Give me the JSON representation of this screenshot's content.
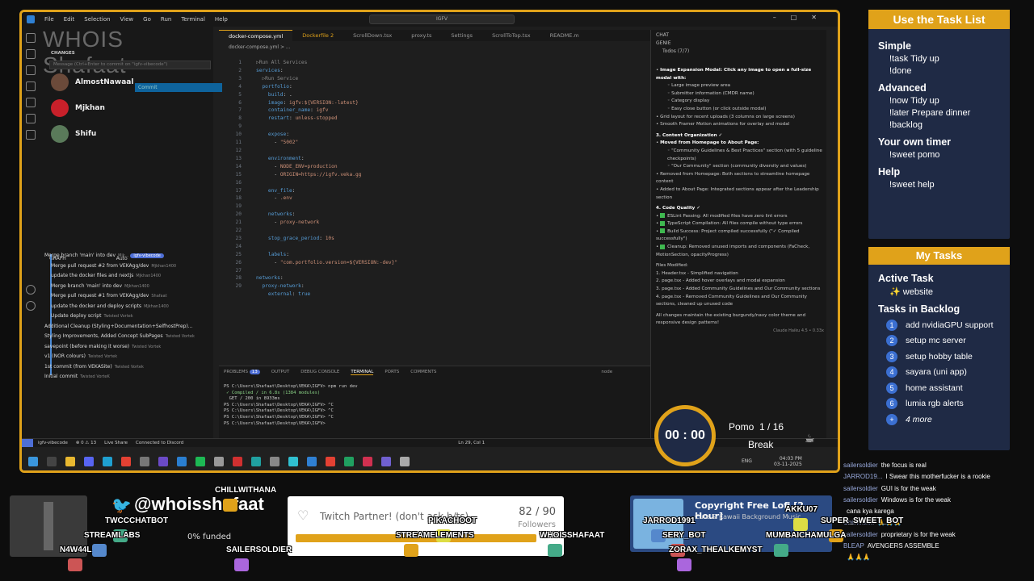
{
  "titlebar": {
    "menu": [
      "File",
      "Edit",
      "Selection",
      "View",
      "Go",
      "Run",
      "Terminal",
      "Help"
    ],
    "search": "IGFV"
  },
  "sidebar": {
    "section": "CHANGES",
    "message_placeholder": "Message (Ctrl+Enter to commit on \"igfv-vibecode\")",
    "commit_label": "Commit",
    "users": [
      "AlmostNawaal",
      "Mjkhan",
      "Shifu"
    ],
    "graph_label": "GRAPH",
    "graph_auto": "Auto"
  },
  "watermark": "WHOIS Shafaat",
  "commits": [
    {
      "msg": "Merge branch 'main' into dev",
      "author": "Mjk...",
      "badge": "igfv-vibecode"
    },
    {
      "msg": "Merge pull request #2 from VEKAgg/dev",
      "author": "Mjkhan1400"
    },
    {
      "msg": "update the docker files and nextjs",
      "author": "Mjkhan1400"
    },
    {
      "msg": "Merge branch 'main' into dev",
      "author": "Mjkhan1400"
    },
    {
      "msg": "Merge pull request #1 from VEKAgg/dev",
      "author": "Shafaat"
    },
    {
      "msg": "update the docker and deploy scripts",
      "author": "Mjkhan1400"
    },
    {
      "msg": "Update deploy script",
      "author": "Twisted Vortek"
    },
    {
      "msg": "Additional Cleanup (Styling+Documentation+SelfhostPrep)...",
      "author": ""
    },
    {
      "msg": "Styling Improvements, Added Concept SubPages",
      "author": "Twisted Vortek"
    },
    {
      "msg": "savepoint (before making it worse)",
      "author": "Twisted Vortek"
    },
    {
      "msg": "v1 (NOR colours)",
      "author": "Twisted Vortek"
    },
    {
      "msg": "1st commit (from VEKASite)",
      "author": "Twisted Vortek"
    },
    {
      "msg": "Initial commit",
      "author": "Twisted VorteK"
    }
  ],
  "tabs": [
    "docker-compose.yml",
    "Dockerfile 2",
    "ScrollDown.tsx",
    "proxy.ts",
    "Settings",
    "ScrollToTop.tsx",
    "README.m"
  ],
  "breadcrumb": "docker-compose.yml > ...",
  "editor": {
    "lines": [
      "1",
      "2",
      "3",
      "4",
      "5",
      "6",
      "7",
      "8",
      "9",
      "10",
      "11",
      "12",
      "13",
      "14",
      "15",
      "16",
      "17",
      "18",
      "19",
      "20",
      "21",
      "22",
      "23",
      "24",
      "25",
      "26",
      "27",
      "28",
      "29"
    ]
  },
  "panel": {
    "tabs": [
      "PROBLEMS",
      "OUTPUT",
      "DEBUG CONSOLE",
      "TERMINAL",
      "PORTS",
      "COMMENTS"
    ],
    "problems_count": "13",
    "shell": "node"
  },
  "terminal": [
    "PS C:\\Users\\Shafaat\\Desktop\\VEKA\\IGFV> npm run dev",
    " ✓ Compiled / in 6.8s (1384 modules)",
    "  GET / 200 in 8933ms",
    "PS C:\\Users\\Shafaat\\Desktop\\VEKA\\IGFV> ^C",
    "PS C:\\Users\\Shafaat\\Desktop\\VEKA\\IGFV> ^C",
    "PS C:\\Users\\Shafaat\\Desktop\\VEKA\\IGFV> ^C",
    "PS C:\\Users\\Shafaat\\Desktop\\VEKA\\IGFV> "
  ],
  "chat": {
    "title": "CHAT",
    "sub": "GENIE",
    "todos": "Todos (7/7)",
    "items": [
      "Image Expansion Modal: Click any image to open a full-size modal with:",
      "Large image preview area",
      "Submitter information (CMDR name)",
      "Category display",
      "Easy close button (or click outside modal)",
      "Grid layout for recent uploads (3 columns on large screens)",
      "Smooth Framer Motion animations for overlay and modal",
      "3. Content Organization ✓",
      "Moved from Homepage to About Page:",
      "\"Community Guidelines & Best Practices\" section (with 5 guideline checkpoints)",
      "\"Our Community\" section (community diversity and values)",
      "Removed from Homepage: Both sections to streamline homepage content",
      "Added to About Page: Integrated sections appear after the Leadership section",
      "4. Code Quality ✓",
      "ESLint Passing: All modified files have zero lint errors",
      "TypeScript Compilation: All files compile without type errors",
      "Build Success: Project compiled successfully (\"✓ Compiled successfully\")",
      "Cleanup: Removed unused imports and components (FaCheck, MotionSection, opacityProgress)",
      "Files Modified:",
      "Header.tsx - Simplified navigation",
      "page.tsx - Added hover overlays and modal expansion",
      "page.tsx - Added Community Guidelines and Our Community sections",
      "page.tsx - Removed Community Guidelines and Our Community sections, cleaned up unused code",
      "All changes maintain the existing burgundy/navy color theme and responsive design patterns!"
    ],
    "model": "Claude Haiku 4.5 • 0.33x"
  },
  "status": {
    "branch": "igfv-vibecode",
    "problems": "⊗ 0 ⚠ 13",
    "live": "Live Share",
    "discord": "Connected to Discord",
    "pos": "Ln 29, Col 1",
    "time": "04:03 PM",
    "date": "03-11-2025",
    "lang": "ENG"
  },
  "tasklist": {
    "title": "Use the Task List",
    "sections": [
      {
        "h": "Simple",
        "items": [
          "!task Tidy up",
          "!done"
        ]
      },
      {
        "h": "Advanced",
        "items": [
          "!now Tidy up",
          "!later Prepare dinner",
          "!backlog"
        ]
      },
      {
        "h": "Your own timer",
        "items": [
          "!sweet pomo"
        ]
      },
      {
        "h": "Help",
        "items": [
          "!sweet help"
        ]
      }
    ]
  },
  "mytasks": {
    "title": "My Tasks",
    "active_label": "Active Task",
    "active": "✨ website",
    "backlog_label": "Tasks in Backlog",
    "backlog": [
      "add nvidiaGPU support",
      "setup mc server",
      "setup hobby table",
      "sayara (uni app)",
      "home assistant",
      "lumia rgb alerts"
    ],
    "more": "4 more"
  },
  "pomo": {
    "time": "00 : 00",
    "label": "Pomo",
    "count": "1 / 16",
    "state": "Break"
  },
  "chatlog": [
    {
      "u": "sailersoldier",
      "m": "the focus is real"
    },
    {
      "u": "JARROD19...",
      "m": "I Swear this motherfucker is a rookie"
    },
    {
      "u": "sailersoldier",
      "m": "GUI is for the weak"
    },
    {
      "u": "sailersoldier",
      "m": "Windows is for the weak"
    },
    {
      "u": "",
      "m": "cana kya karega"
    },
    {
      "u": "ChillWith...",
      "m": "🙏🙏🙏"
    },
    {
      "u": "sailersoldier",
      "m": "proprietary is for the weak"
    },
    {
      "u": "BLEAP",
      "m": "AVENGERS ASSEMBLE"
    },
    {
      "u": "",
      "m": "🙏🙏🙏"
    }
  ],
  "overlay": {
    "twitter": "@whoisshafaat",
    "partner": "Twitch Partner! (don't ask h/ts)",
    "followers": "82 / 90",
    "followers_label": "Followers",
    "funded": "0% funded",
    "song": "Copyright Free Lofi [2 Hour]",
    "song_sub": "Cute & Kawaii Background Music",
    "names": [
      "CHILLWITHANA",
      "TWCCCHATBOT",
      "STREAMLABS",
      "N4W44L",
      "SAILERSOLDIER",
      "PIKACHOOT",
      "STREAMELEMENTS",
      "WHOISSHAFAAT",
      "JARROD1991",
      "SERY_BOT",
      "ZORAX_THEALKEMYST",
      "AKKU07",
      "SUPER_SWEET_BOT",
      "MUMBAICHAMULGA"
    ]
  }
}
